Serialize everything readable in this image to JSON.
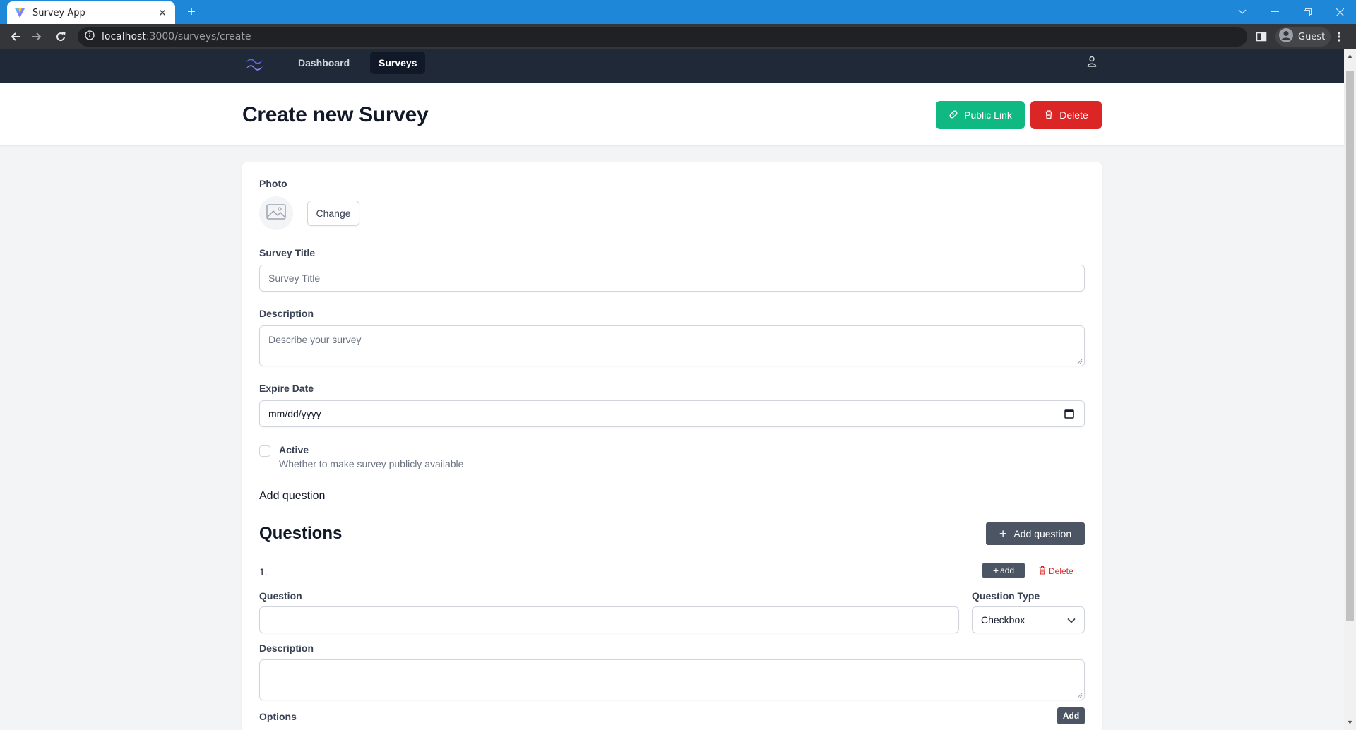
{
  "browser": {
    "tab_title": "Survey App",
    "url_host": "localhost",
    "url_path": ":3000/surveys/create",
    "profile_name": "Guest"
  },
  "nav": {
    "items": [
      {
        "label": "Dashboard",
        "active": false
      },
      {
        "label": "Surveys",
        "active": true
      }
    ],
    "user_icon": "user-icon"
  },
  "header": {
    "title": "Create new Survey",
    "public_link_label": "Public Link",
    "delete_label": "Delete"
  },
  "form": {
    "photo_label": "Photo",
    "change_label": "Change",
    "title_label": "Survey Title",
    "title_placeholder": "Survey Title",
    "description_label": "Description",
    "description_placeholder": "Describe your survey",
    "expire_label": "Expire Date",
    "expire_value": "mm/dd/yyyy",
    "active_label": "Active",
    "active_help": "Whether to make survey publicly available",
    "active_checked": false,
    "add_question_text": "Add question"
  },
  "questions": {
    "heading": "Questions",
    "add_button_label": "Add question",
    "items": [
      {
        "number": "1.",
        "add_label": "add",
        "delete_label": "Delete",
        "question_label": "Question",
        "question_value": "",
        "type_label": "Question Type",
        "type_value": "Checkbox",
        "description_label": "Description",
        "description_value": "",
        "options_label": "Options",
        "options_add_label": "Add"
      }
    ]
  },
  "colors": {
    "titlebar": "#1f87d8",
    "navbar": "#1f2937",
    "public_link": "#10b981",
    "delete": "#dc2626",
    "dark_button": "#4b5563"
  }
}
